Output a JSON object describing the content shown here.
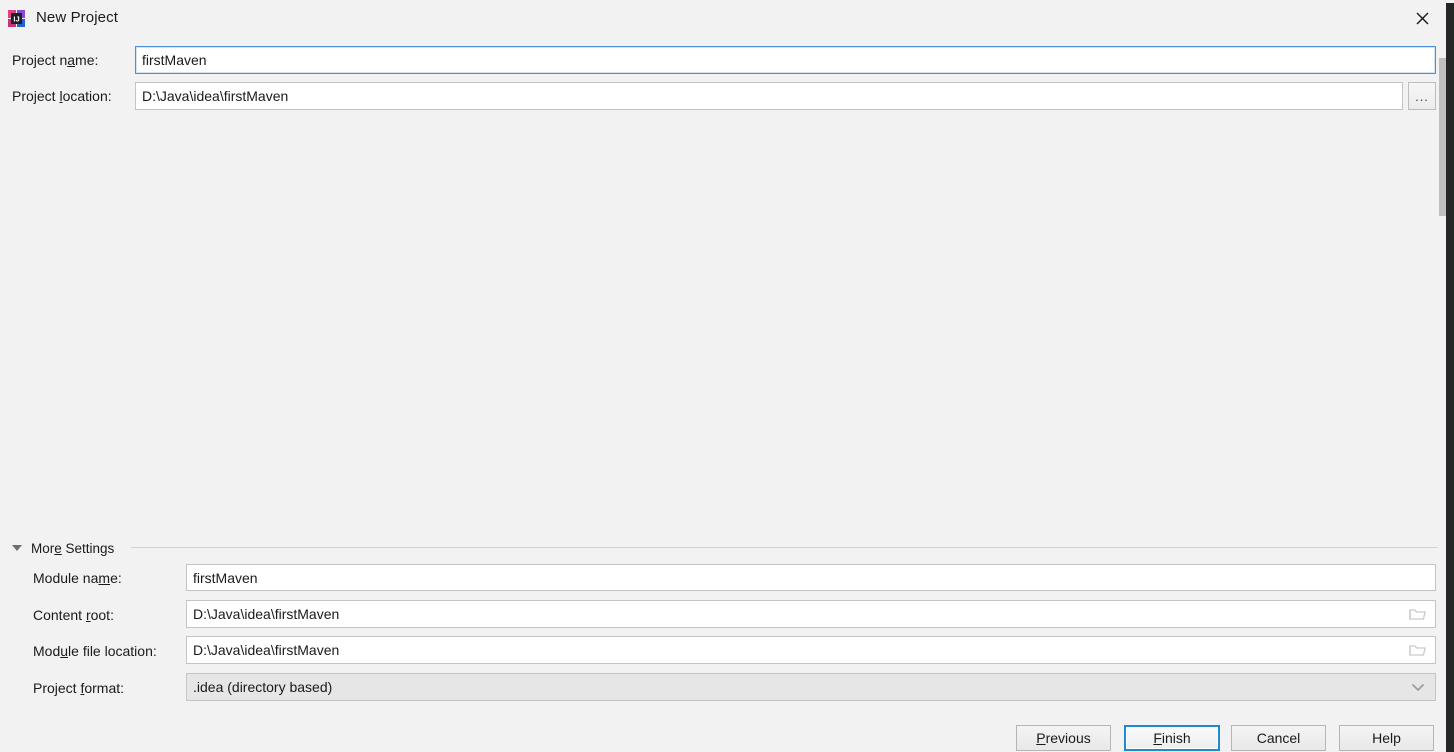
{
  "window": {
    "title": "New Project",
    "app_icon": "intellij-idea-icon",
    "close_icon": "close-icon"
  },
  "top_form": {
    "project_name": {
      "label": "Project name:",
      "mnemonic": "a",
      "value": "firstMaven",
      "focused": true
    },
    "project_location": {
      "label": "Project location:",
      "mnemonic": "l",
      "value": "D:\\Java\\idea\\firstMaven",
      "browse_label": "..."
    }
  },
  "more_settings": {
    "header_label": "More Settings",
    "header_mnemonic": "e",
    "expanded": true,
    "collapse_icon": "triangle-down-icon",
    "rows": [
      {
        "name": "module-name",
        "label": "Module name:",
        "mnemonic": "m",
        "value": "firstMaven",
        "trailing_icon": null,
        "type": "text"
      },
      {
        "name": "content-root",
        "label": "Content root:",
        "mnemonic": "r",
        "value": "D:\\Java\\idea\\firstMaven",
        "trailing_icon": "folder-icon",
        "type": "text"
      },
      {
        "name": "module-file-location",
        "label": "Module file location:",
        "mnemonic": "u",
        "value": "D:\\Java\\idea\\firstMaven",
        "trailing_icon": "folder-icon",
        "type": "text"
      },
      {
        "name": "project-format",
        "label": "Project format:",
        "mnemonic": "f",
        "value": ".idea (directory based)",
        "trailing_icon": "chevron-down-icon",
        "type": "combo"
      }
    ]
  },
  "buttons": {
    "previous": {
      "label": "Previous",
      "mnemonic": "P",
      "default": false
    },
    "finish": {
      "label": "Finish",
      "mnemonic": "F",
      "default": true
    },
    "cancel": {
      "label": "Cancel",
      "mnemonic": "",
      "default": false
    },
    "help": {
      "label": "Help",
      "mnemonic": "",
      "default": false
    }
  },
  "colors": {
    "background": "#f2f2f2",
    "field_background": "#ffffff",
    "combo_background": "#e6e6e6",
    "focus_blue": "#4a90d9",
    "default_button_blue": "#1f8ad2",
    "border_gray": "#c4c4c4",
    "text": "#1a1a1a"
  }
}
